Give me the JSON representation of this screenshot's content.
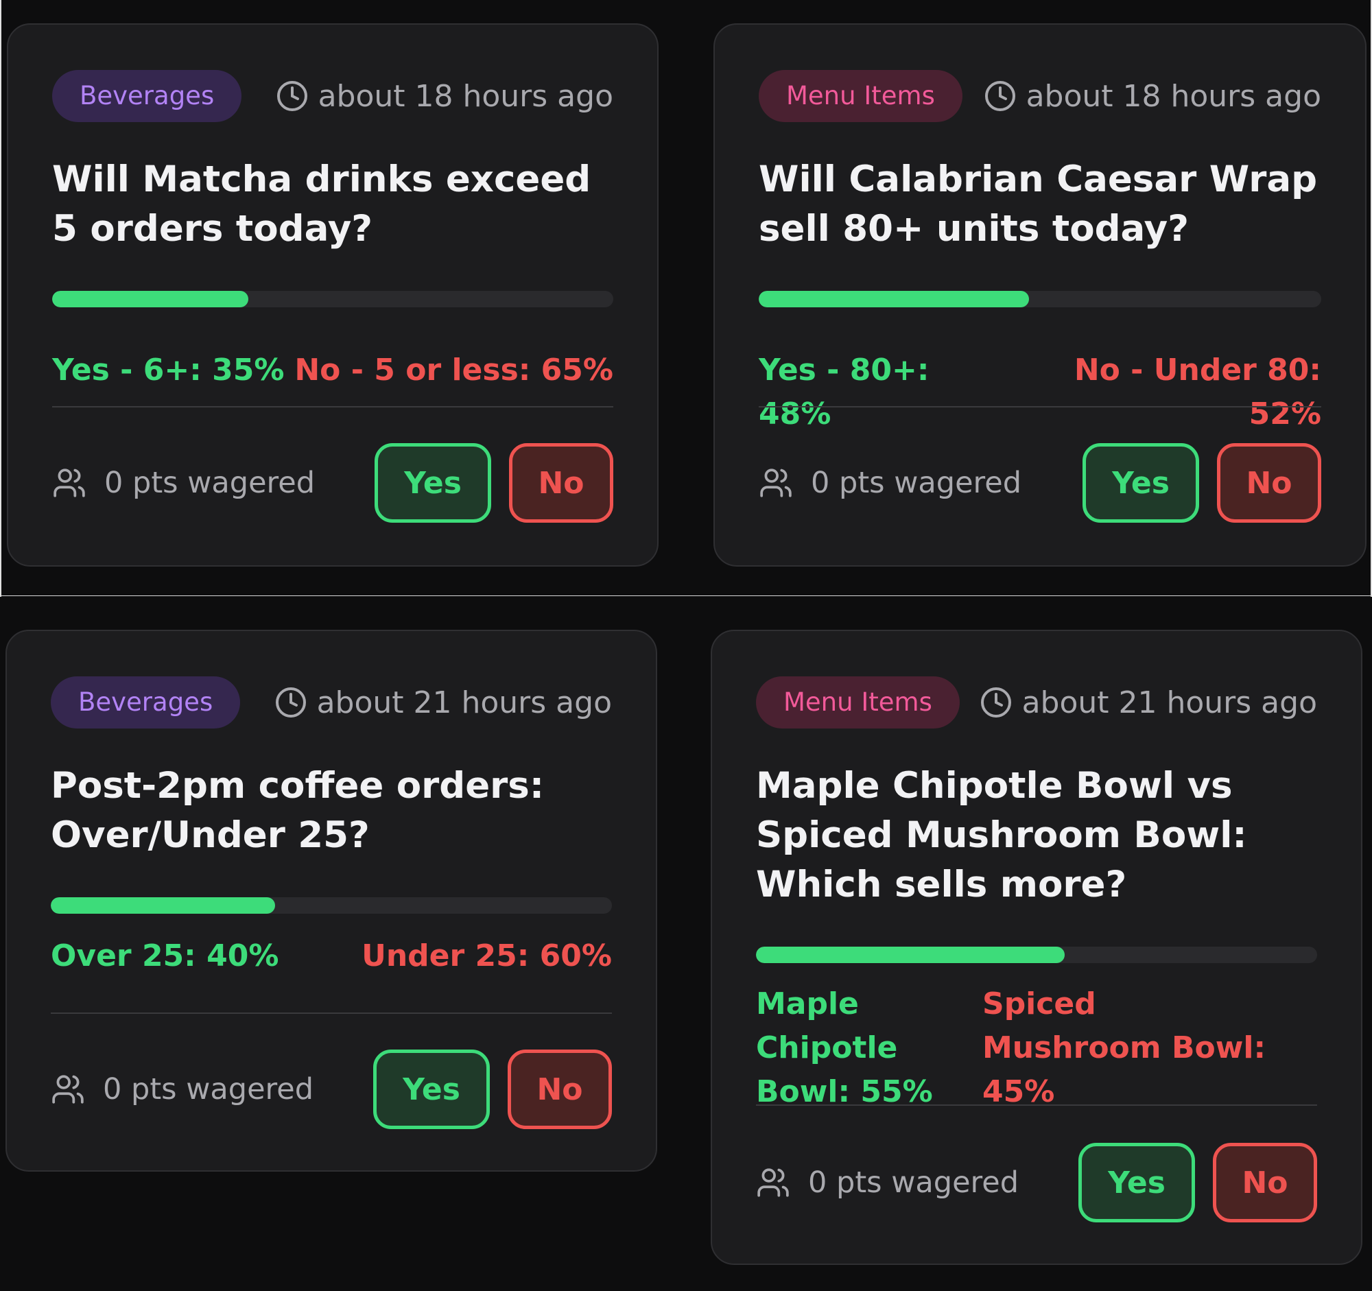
{
  "colors": {
    "yes": "#3ddc7a",
    "no": "#ef5350",
    "beverages_badge": "#b283f5",
    "menu_badge": "#f25a9a",
    "card_bg": "#1c1c1e"
  },
  "cards": [
    {
      "category": "Beverages",
      "time": "about 18 hours ago",
      "question": "Will Matcha drinks exceed 5 orders today?",
      "yes_fraction": 0.35,
      "yes_label": "Yes - 6+: 35%",
      "no_label": "No - 5 or less: 65%",
      "wagered": "0 pts wagered",
      "yes_button": "Yes",
      "no_button": "No"
    },
    {
      "category": "Menu Items",
      "time": "about 18 hours ago",
      "question": "Will Calabrian Caesar Wrap sell 80+ units today?",
      "yes_fraction": 0.48,
      "yes_label": "Yes - 80+: 48%",
      "no_label": "No - Under 80: 52%",
      "wagered": "0 pts wagered",
      "yes_button": "Yes",
      "no_button": "No"
    },
    {
      "category": "Beverages",
      "time": "about 21 hours ago",
      "question": "Post-2pm coffee orders: Over/Under 25?",
      "yes_fraction": 0.4,
      "yes_label": "Over 25: 40%",
      "no_label": "Under 25: 60%",
      "wagered": "0 pts wagered",
      "yes_button": "Yes",
      "no_button": "No"
    },
    {
      "category": "Menu Items",
      "time": "about 21 hours ago",
      "question": "Maple Chipotle Bowl vs Spiced Mushroom Bowl: Which sells more?",
      "yes_fraction": 0.55,
      "yes_label": "Maple Chipotle Bowl: 55%",
      "no_label": "Spiced Mushroom Bowl: 45%",
      "wagered": "0 pts wagered",
      "yes_button": "Yes",
      "no_button": "No"
    }
  ]
}
